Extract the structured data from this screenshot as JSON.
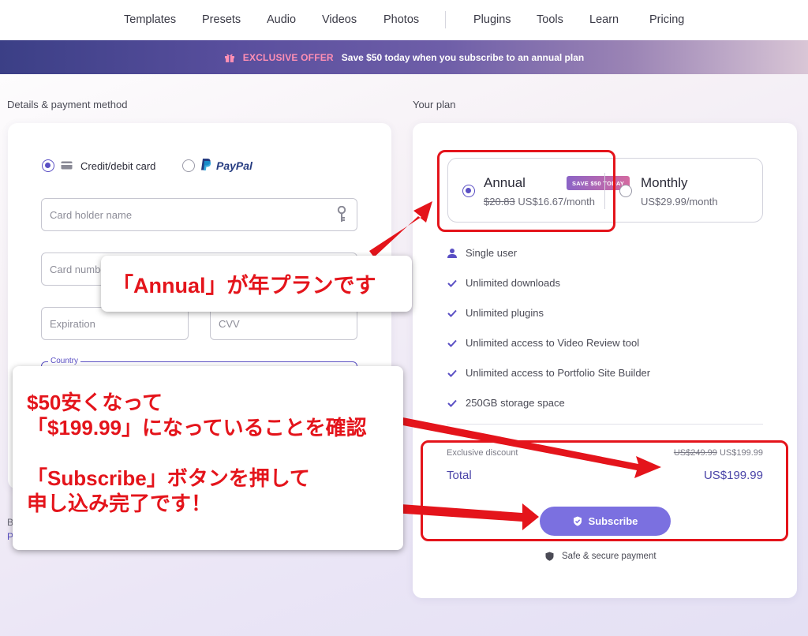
{
  "nav": {
    "items": [
      "Templates",
      "Presets",
      "Audio",
      "Videos",
      "Photos",
      "Plugins",
      "Tools",
      "Learn",
      "Pricing"
    ]
  },
  "banner": {
    "exclusive": "EXCLUSIVE OFFER",
    "offer": "Save $50 today when you subscribe to an annual plan"
  },
  "left": {
    "section_title": "Details & payment method",
    "method_card": "Credit/debit card",
    "method_paypal": "PayPal",
    "card_holder_placeholder": "Card holder name",
    "card_number_placeholder": "Card number",
    "expiration_placeholder": "Expiration",
    "cvv_placeholder": "CVV",
    "country_label": "Country",
    "footer_b": "B",
    "footer_p": "P"
  },
  "right": {
    "section_title": "Your plan",
    "annual_label": "Annual",
    "annual_badge": "SAVE $50 TODAY",
    "annual_old_price": "$20.83",
    "annual_price": "US$16.67/month",
    "monthly_label": "Monthly",
    "monthly_price": "US$29.99/month",
    "features": [
      "Single user",
      "Unlimited downloads",
      "Unlimited plugins",
      "Unlimited access to Video Review tool",
      "Unlimited access to Portfolio Site Builder",
      "250GB storage space"
    ],
    "discount_label": "Exclusive discount",
    "discount_old": "US$249.99",
    "discount_new": "US$199.99",
    "total_label": "Total",
    "total_value": "US$199.99",
    "subscribe_label": "Subscribe",
    "secure_label": "Safe & secure payment"
  },
  "annotations": {
    "callout1": "「Annual」が年プランです",
    "callout2_line1": "$50安くなって",
    "callout2_line2": "「$199.99」になっていることを確認",
    "callout2_line3": "「Subscribe」ボタンを押して",
    "callout2_line4": "申し込み完了です！"
  },
  "colors": {
    "accent": "#5a4fc4",
    "subscribe": "#7b70e0",
    "annotation_red": "#e4141b",
    "paypal_dark": "#253b80",
    "paypal_light": "#179bd7"
  }
}
